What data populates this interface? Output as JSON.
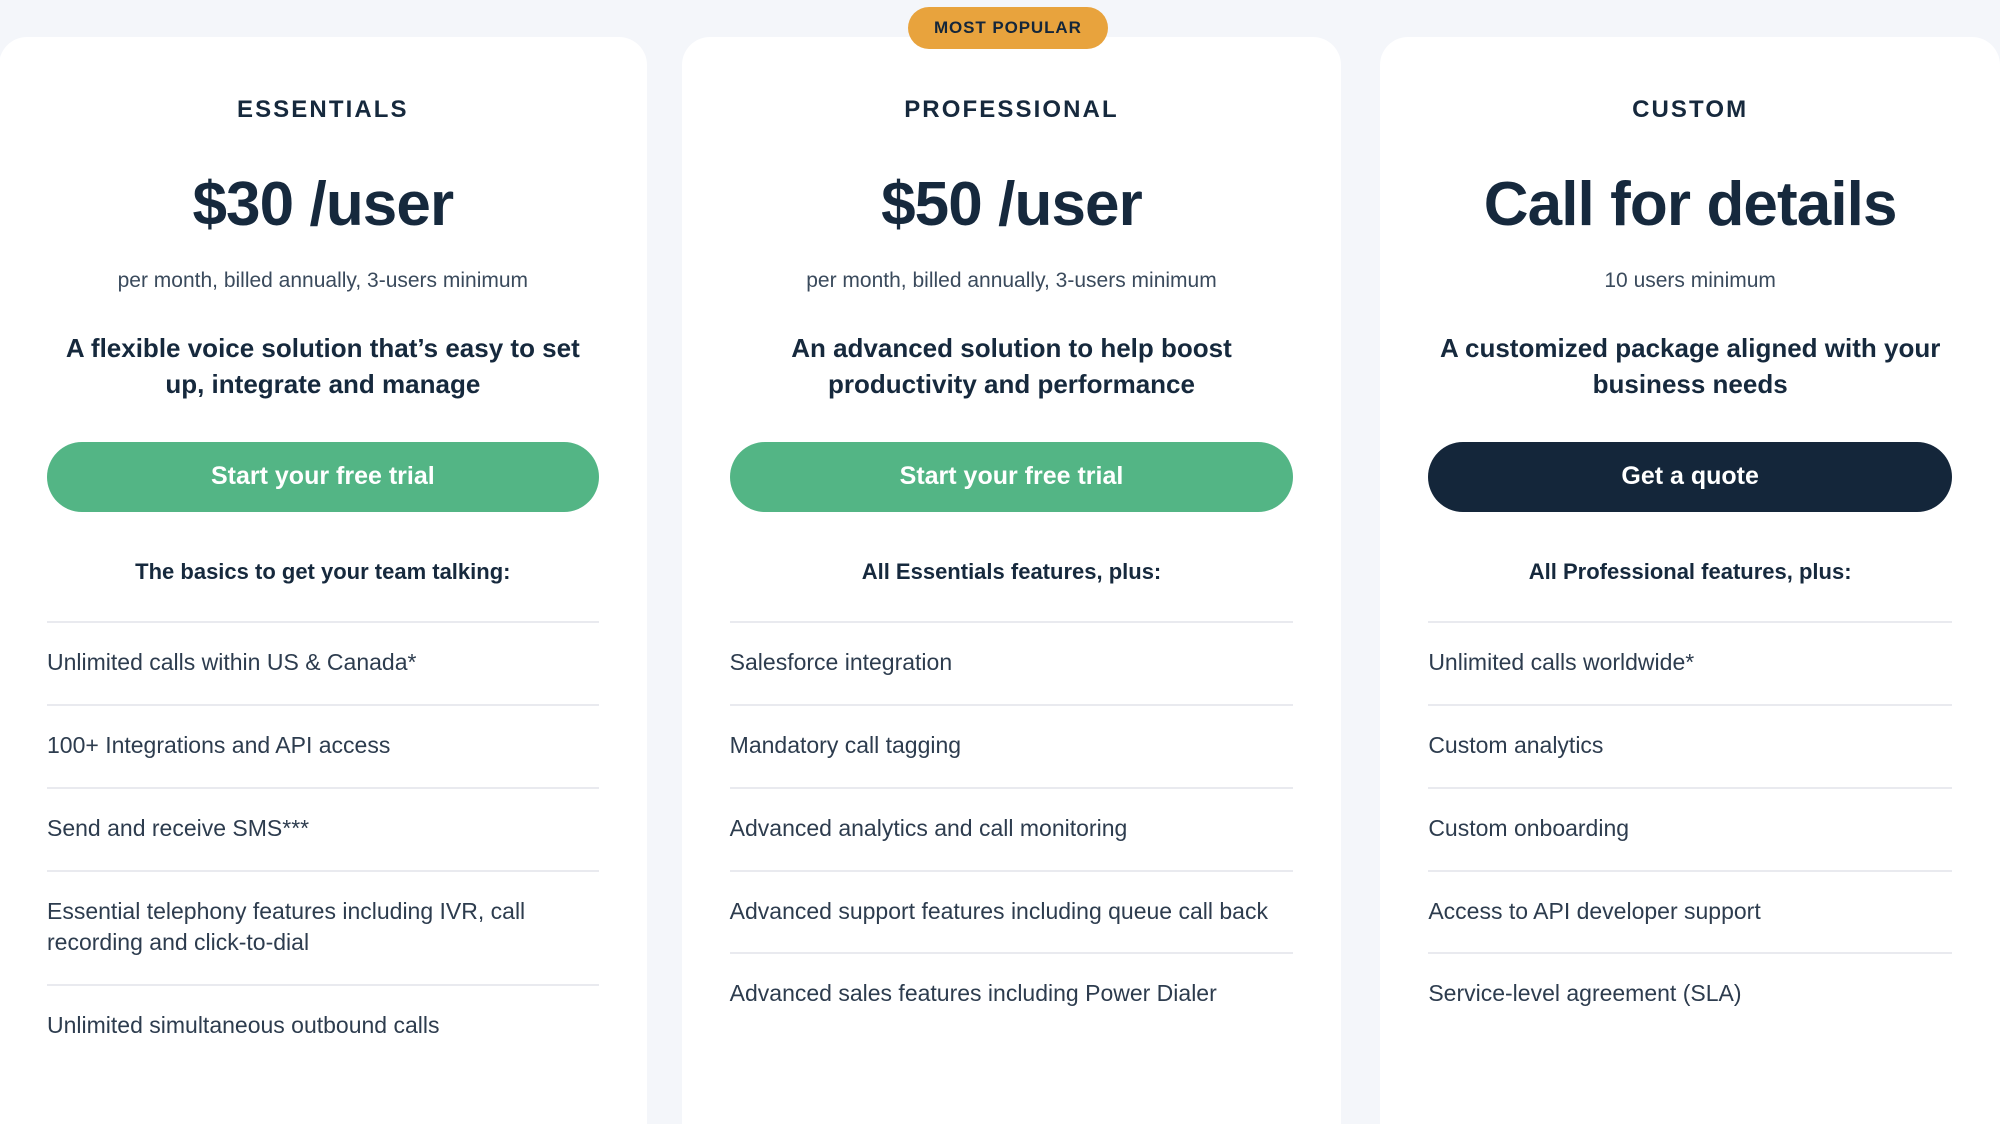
{
  "theme": {
    "page_background": "#f4f6fa",
    "card_background": "#ffffff",
    "text_dark": "#16293d",
    "accent_green": "#53b585",
    "accent_orange": "#e8a33d",
    "divider": "#e9eaef"
  },
  "badge": {
    "label": "MOST POPULAR"
  },
  "plans": [
    {
      "id": "essentials",
      "name": "ESSENTIALS",
      "price": "$30 /user",
      "price_note": "per month, billed annually, 3-users minimum",
      "tagline": "A flexible voice solution that’s easy to set up, integrate and manage",
      "cta_label": "Start your free trial",
      "cta_style": "green",
      "features_heading": "The basics to get your team talking:",
      "features": [
        "Unlimited calls within US & Canada*",
        "100+ Integrations and API access",
        "Send and receive SMS***",
        "Essential telephony features including IVR, call recording and click-to-dial",
        "Unlimited simultaneous outbound calls"
      ]
    },
    {
      "id": "professional",
      "name": "PROFESSIONAL",
      "price": "$50 /user",
      "price_note": "per month, billed annually, 3-users minimum",
      "tagline": "An advanced solution to help boost productivity and performance",
      "cta_label": "Start your free trial",
      "cta_style": "green",
      "features_heading": "All Essentials features, plus:",
      "features": [
        "Salesforce integration",
        "Mandatory call tagging",
        "Advanced analytics and call monitoring",
        "Advanced support features including queue call back",
        "Advanced sales features including Power Dialer"
      ]
    },
    {
      "id": "custom",
      "name": "CUSTOM",
      "price": "Call for details",
      "price_note": "10 users minimum",
      "tagline": "A customized package aligned with your business needs",
      "cta_label": "Get a quote",
      "cta_style": "dark",
      "features_heading": "All Professional features, plus:",
      "features": [
        "Unlimited calls worldwide*",
        "Custom analytics",
        "Custom onboarding",
        "Access to API developer support",
        "Service-level agreement (SLA)"
      ]
    }
  ]
}
